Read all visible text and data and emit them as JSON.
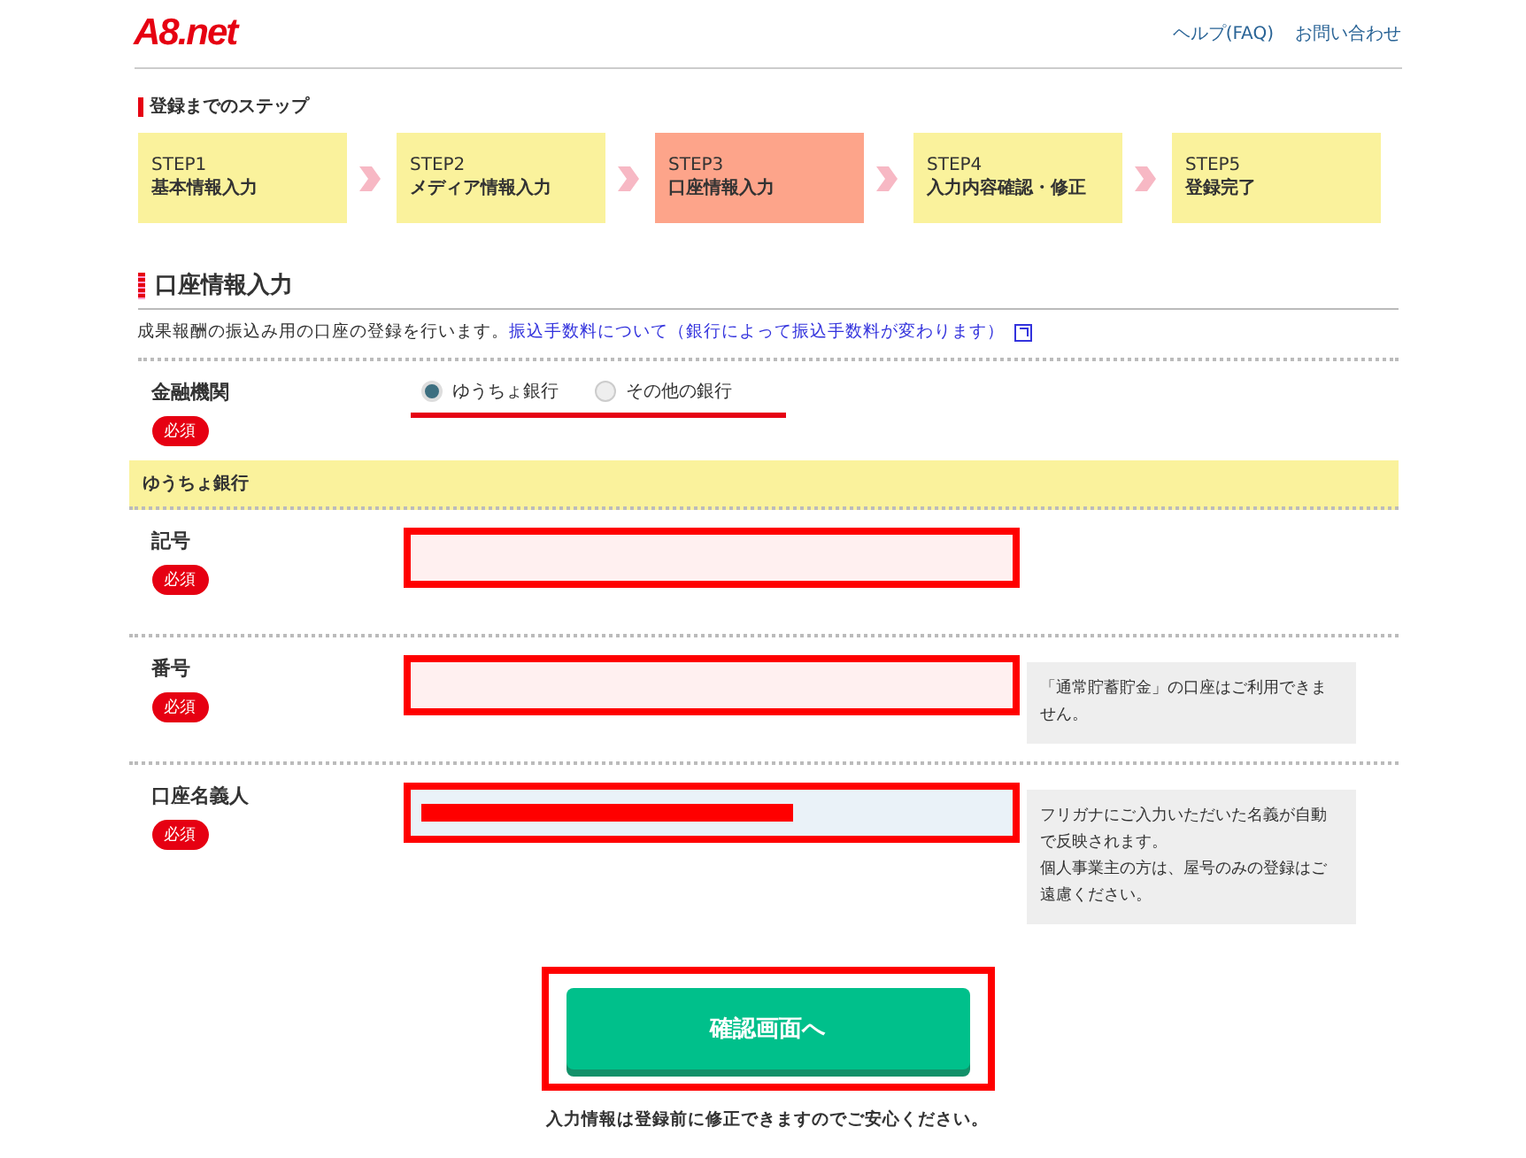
{
  "header": {
    "logo": "A8.net",
    "links": [
      "ヘルプ(FAQ)",
      "お問い合わせ"
    ]
  },
  "steps_heading": "登録までのステップ",
  "steps": [
    {
      "label": "STEP1",
      "title": "基本情報入力",
      "selected": false
    },
    {
      "label": "STEP2",
      "title": "メディア情報入力",
      "selected": false
    },
    {
      "label": "STEP3",
      "title": "口座情報入力",
      "selected": true
    },
    {
      "label": "STEP4",
      "title": "入力内容確認・修正",
      "selected": false
    },
    {
      "label": "STEP5",
      "title": "登録完了",
      "selected": false
    }
  ],
  "section": {
    "title": "口座情報入力",
    "description": "成果報酬の振込み用の口座の登録を行います。",
    "link": "振込手数料について（銀行によって振込手数料が変わります）"
  },
  "bank": {
    "label": "金融機関",
    "required": "必須",
    "highlighted": true,
    "options": [
      {
        "label": "ゆうちょ銀行",
        "selected": true
      },
      {
        "label": "その他の銀行",
        "selected": false
      }
    ]
  },
  "subsection": "ゆうちょ銀行",
  "fields": [
    {
      "label": "記号",
      "required": "必須",
      "filled": false,
      "redacted": false,
      "highlighted": true
    },
    {
      "label": "番号",
      "required": "必須",
      "filled": false,
      "redacted": false,
      "highlighted": true,
      "notes": [
        "「通常貯蓄貯金」の口座はご利用できません。"
      ]
    },
    {
      "label": "口座名義人",
      "required": "必須",
      "filled": true,
      "redacted": true,
      "highlighted": true,
      "notes": [
        "フリガナにご入力いただいた名義が自動で反映されます。",
        "個人事業主の方は、屋号のみの登録はご遠慮ください。"
      ]
    }
  ],
  "submit": {
    "label": "確認画面へ",
    "highlighted": true
  },
  "footnote": "入力情報は登録前に修正できますのでご安心ください。"
}
